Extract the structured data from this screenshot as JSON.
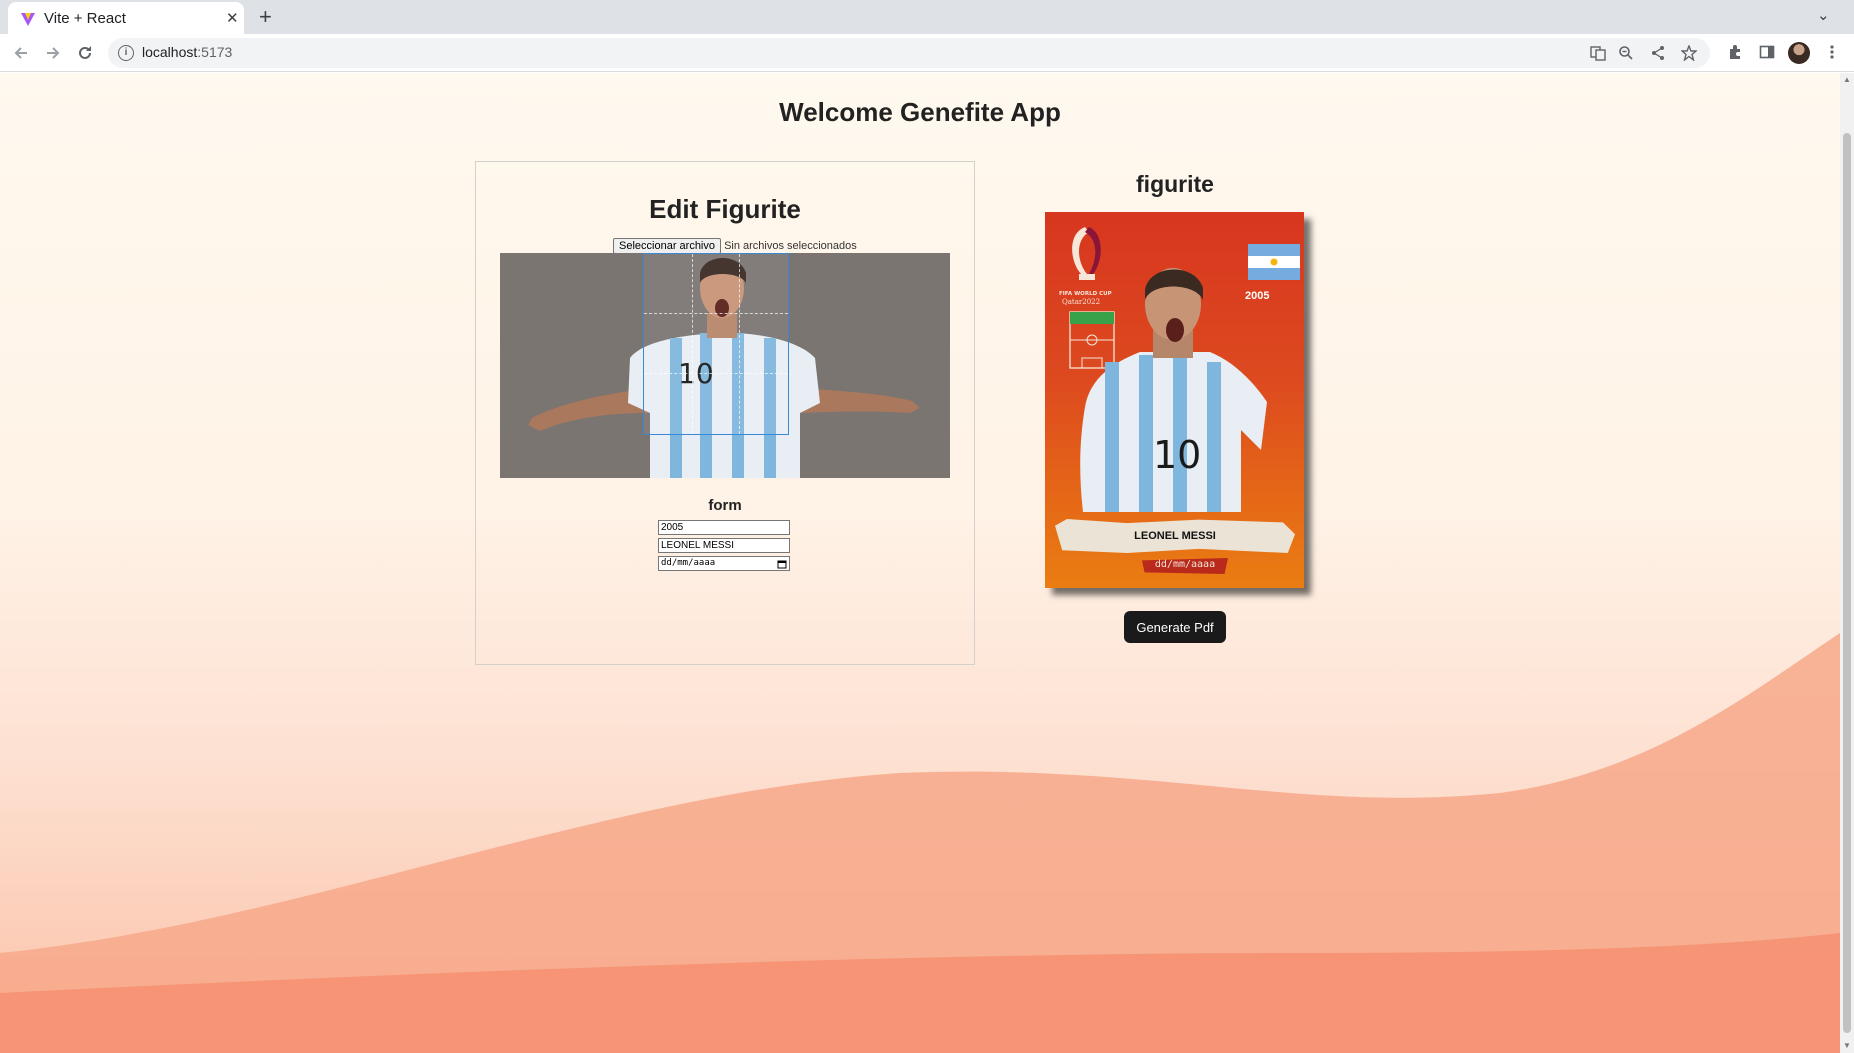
{
  "browser": {
    "tab_title": "Vite + React",
    "tab_close": "✕",
    "new_tab": "+",
    "tab_search": "⌄",
    "url_host": "localhost",
    "url_port": ":5173",
    "icons": [
      "back-arrow-icon",
      "forward-arrow-icon",
      "reload-icon",
      "site-info-icon",
      "translate-icon",
      "zoom-icon",
      "share-icon",
      "bookmark-star-icon",
      "extensions-icon",
      "side-panel-icon",
      "profile-avatar",
      "menu-icon"
    ]
  },
  "page": {
    "title": "Welcome Genefite App",
    "editor": {
      "title": "Edit Figurite",
      "file_button": "Seleccionar archivo",
      "file_status": "Sin archivos seleccionados",
      "form_label": "form",
      "year_value": "2005",
      "name_value": "LEONEL MESSI",
      "date_placeholder": "dd/mm/aaaa"
    },
    "preview": {
      "title": "figurite",
      "card_year": "2005",
      "card_name": "LEONEL MESSI",
      "card_date": "dd/mm/aaaa",
      "colors": {
        "card_top": "#d7361f",
        "card_bottom": "#ea7d12"
      }
    },
    "generate_button": "Generate Pdf"
  }
}
